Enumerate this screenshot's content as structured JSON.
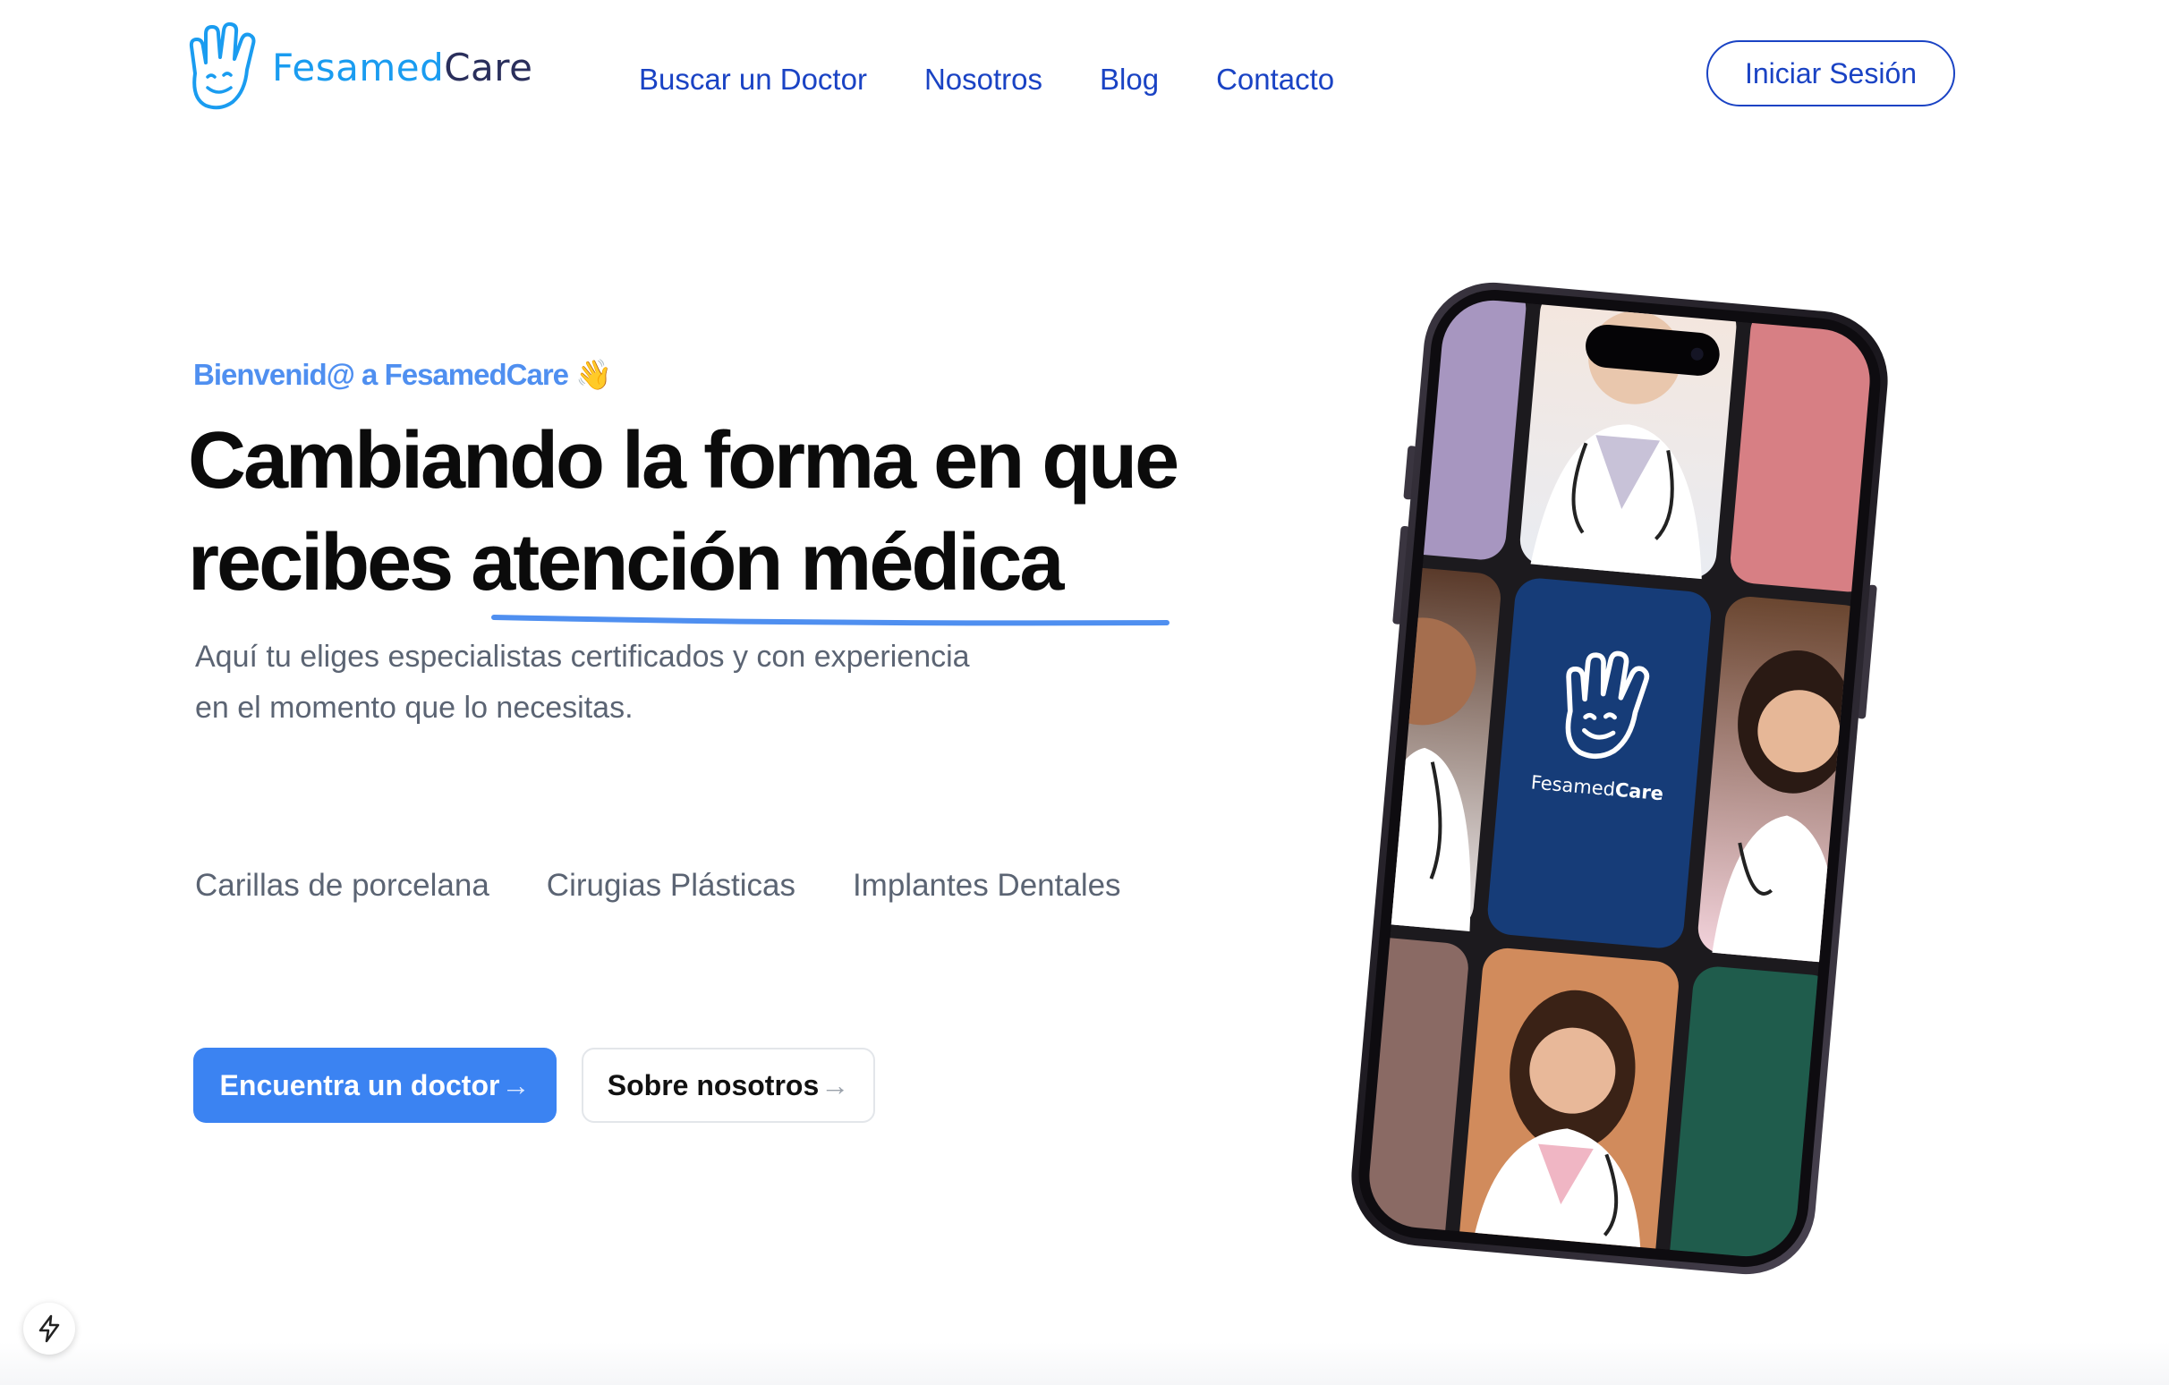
{
  "brand": {
    "part1": "Fesamed",
    "part2": "Care",
    "logo_icon": "waving-hand-smile-icon",
    "colors": {
      "primary": "#1a9cf0",
      "dark": "#2a2f5c"
    }
  },
  "nav": {
    "items": [
      {
        "label": "Buscar un Doctor"
      },
      {
        "label": "Nosotros"
      },
      {
        "label": "Blog"
      },
      {
        "label": "Contacto"
      }
    ],
    "login_label": "Iniciar Sesión",
    "color": "#1a43c4"
  },
  "hero": {
    "welcome": "Bienvenid@ a FesamedCare",
    "welcome_emoji": "👋",
    "headline_line1": "Cambiando la forma en que",
    "headline_line2_a": "recibes ",
    "headline_line2_b": "atención médica",
    "subtitle_line1": "Aquí tu eliges especialistas certificados y con experiencia",
    "subtitle_line2": "en el momento que lo necesitas.",
    "specialties": [
      "Carillas de porcelana",
      "Cirugias Plásticas",
      "Implantes Dentales"
    ],
    "primary_button": "Encuentra un doctor",
    "secondary_button": "Sobre nosotros",
    "arrow": "→",
    "accent_color": "#3b83f2"
  },
  "phone": {
    "app_name_a": "Fesamed",
    "app_name_b": "Care",
    "screen_bg": "#163c78"
  },
  "badge": {
    "icon": "lightning-bolt-icon"
  }
}
